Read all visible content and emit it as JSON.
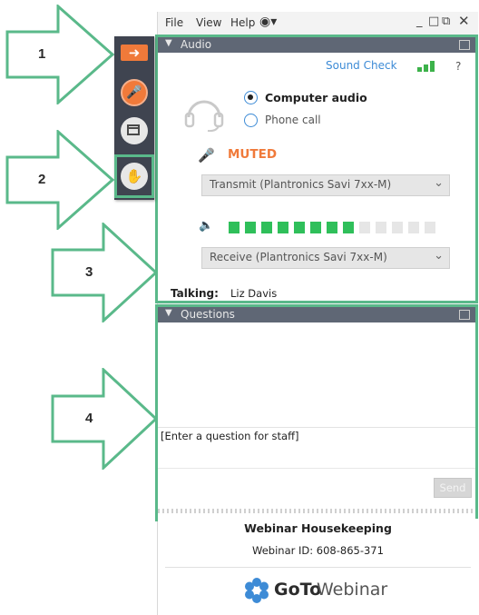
{
  "callouts": [
    {
      "number": "1"
    },
    {
      "number": "2"
    },
    {
      "number": "3"
    },
    {
      "number": "4"
    }
  ],
  "menu": {
    "file": "File",
    "view": "View",
    "help": "Help"
  },
  "toolbar": {
    "icons": [
      "arrow-right-icon",
      "microphone-muted-icon",
      "screen-icon",
      "raise-hand-icon"
    ]
  },
  "audio": {
    "header": "Audio",
    "sound_check": "Sound Check",
    "help_mark": "?",
    "computer_audio": "Computer audio",
    "phone_call": "Phone call",
    "selected_mode": "Computer audio",
    "muted_label": "MUTED",
    "transmit_value": "Transmit (Plantronics Savi 7xx-M)",
    "receive_value": "Receive (Plantronics Savi 7xx-M)",
    "level_active_segments": 8,
    "level_total_segments": 13,
    "talking_label": "Talking:",
    "talking_name": "Liz Davis"
  },
  "questions": {
    "header": "Questions",
    "input_placeholder": "[Enter a question for staff]",
    "send_label": "Send"
  },
  "footer": {
    "title": "Webinar Housekeeping",
    "webinar_id": "Webinar ID: 608-865-371",
    "brand_goto": "GoTo",
    "brand_webinar": "Webinar"
  },
  "colors": {
    "accent_green": "#5ab98a",
    "muted_orange": "#f07a3a",
    "link_blue": "#3d8bd6",
    "toolbar_dark": "#3f4450",
    "header_gray": "#5f6775"
  }
}
